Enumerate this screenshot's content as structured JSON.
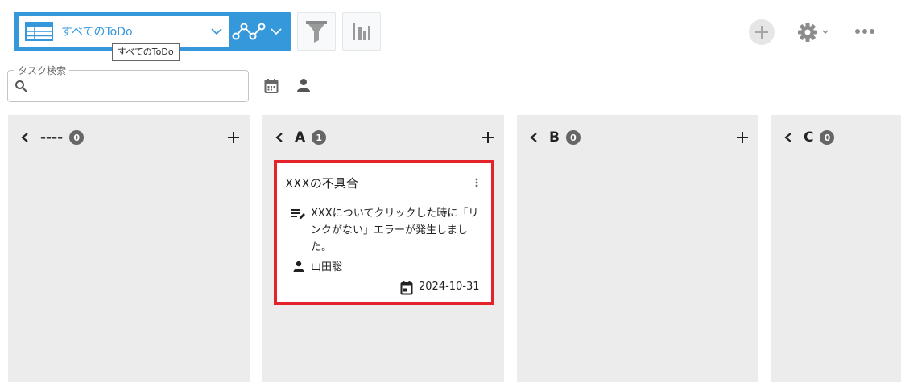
{
  "toolbar": {
    "view_name": "すべてのToDo",
    "tooltip": "すべてのToDo"
  },
  "search": {
    "label": "タスク検索",
    "value": ""
  },
  "columns": [
    {
      "title": "----",
      "count": "0"
    },
    {
      "title": "A",
      "count": "1"
    },
    {
      "title": "B",
      "count": "0"
    },
    {
      "title": "C",
      "count": "0"
    }
  ],
  "card": {
    "title": "XXXの不具合",
    "description": "XXXについてクリックした時に「リンクがない」エラーが発生しました。",
    "assignee": "山田聡",
    "due_date": "2024-10-31"
  },
  "colors": {
    "accent": "#3498db",
    "column_bg": "#ececec",
    "highlight": "#e32329",
    "badge": "#666666"
  }
}
